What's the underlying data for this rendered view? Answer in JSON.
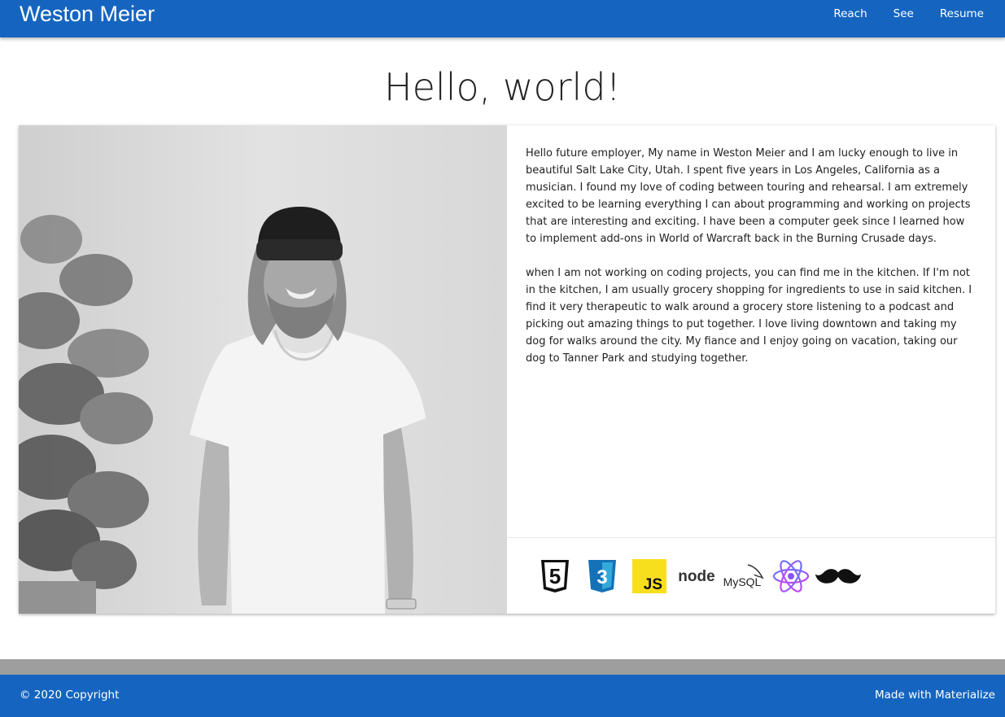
{
  "nav": {
    "brand": "Weston Meier",
    "links": [
      "Reach",
      "See",
      "Resume"
    ]
  },
  "hero": {
    "title": "Hello, world!"
  },
  "about": {
    "paragraphs": [
      "Hello future employer, My name in Weston Meier and I am lucky enough to live in beautiful Salt Lake City, Utah. I spent five years in Los Angeles, California as a musician. I found my love of coding between touring and rehearsal. I am extremely excited to be learning everything I can about programming and working on projects that are interesting and exciting. I have been a computer geek since I learned how to implement add-ons in World of Warcraft back in the Burning Crusade days.",
      "when I am not working on coding projects, you can find me in the kitchen. If I'm not in the kitchen, I am usually grocery shopping for ingredients to use in said kitchen. I find it very therapeutic to walk around a grocery store listening to a podcast and picking out amazing things to put together. I love living downtown and taking my dog for walks around the city. My fiance and I enjoy going on vacation, taking our dog to Tanner Park and studying together."
    ],
    "tech_icons": [
      {
        "name": "html5-icon",
        "label": "5"
      },
      {
        "name": "css3-icon",
        "label": "3"
      },
      {
        "name": "javascript-icon",
        "label": "JS"
      },
      {
        "name": "nodejs-icon",
        "label": "node"
      },
      {
        "name": "mysql-icon",
        "label": "MySQL"
      },
      {
        "name": "react-icon"
      },
      {
        "name": "mustache-icon"
      }
    ]
  },
  "footer": {
    "copyright": "© 2020 Copyright",
    "made_with": "Made with Materialize"
  },
  "colors": {
    "primary": "#1565c0",
    "footer_band": "#9e9e9e"
  }
}
